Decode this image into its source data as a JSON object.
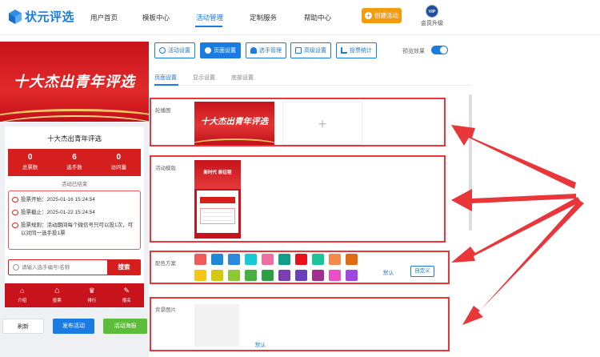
{
  "brand": {
    "name": "状元评选",
    "accent": "#1a7be0",
    "red": "#d51f1f"
  },
  "nav": {
    "items": [
      {
        "label": "用户首页"
      },
      {
        "label": "模板中心"
      },
      {
        "label": "活动管理"
      },
      {
        "label": "定制服务"
      },
      {
        "label": "帮助中心"
      }
    ],
    "active_index": 2,
    "create_label": "创建活动",
    "vip_badge": "VIP",
    "vip_label": "会员升级"
  },
  "preview": {
    "banner_title": "十大杰出青年评选",
    "activity_title": "十大杰出青年评选",
    "stats": [
      {
        "value": "0",
        "label": "总票数"
      },
      {
        "value": "6",
        "label": "选手数"
      },
      {
        "value": "0",
        "label": "访问量"
      }
    ],
    "status": "活动已结束",
    "info": [
      {
        "text": "投票开始：2025-01-16 15:24:54"
      },
      {
        "text": "投票截止：2025-01-22 15:24:54"
      },
      {
        "text": "投票规则：活动期间每个微信号只可以投1次，可以对同一选手投1票"
      }
    ],
    "search_placeholder": "请输入选手编号/名称",
    "search_button": "搜索",
    "tabs": [
      {
        "label": "介绍",
        "icon": "house-small-icon"
      },
      {
        "label": "投票",
        "icon": "home-icon"
      },
      {
        "label": "排行",
        "icon": "trophy-icon"
      },
      {
        "label": "报名",
        "icon": "signup-icon"
      }
    ]
  },
  "bottom_buttons": {
    "refresh": "刷新",
    "publish": "发布活动",
    "poster": "活动海报"
  },
  "toolbar": {
    "buttons": [
      {
        "label": "活动设置",
        "icon": "gear-icon"
      },
      {
        "label": "页面设置",
        "icon": "palette-icon"
      },
      {
        "label": "选手管理",
        "icon": "users-icon"
      },
      {
        "label": "高级设置",
        "icon": "sliders-icon"
      },
      {
        "label": "投票统计",
        "icon": "chart-icon"
      }
    ],
    "active_index": 1,
    "preview_label": "预览效果",
    "preview_on": true
  },
  "subtabs": {
    "items": [
      {
        "label": "页面设置"
      },
      {
        "label": "显示设置"
      },
      {
        "label": "底部设置"
      }
    ],
    "active_index": 0
  },
  "sections": {
    "carousel_label": "轮播图",
    "carousel_image_text": "十大杰出青年评选",
    "template_label": "活动模版",
    "template_banner_text": "新时代 新征程",
    "color_label": "配色方案",
    "colors_row1": [
      "#f05a5a",
      "#1e88d4",
      "#2a8ae0",
      "#18c9d4",
      "#ec6fa0",
      "#10a08a",
      "#e8121a",
      "#1cc49a",
      "#f5894a",
      "#e06a10"
    ],
    "colors_row2": [
      "#f5c518",
      "#d4c810",
      "#8bc834",
      "#48b040",
      "#2e9e46",
      "#7b3fb2",
      "#6a3fba",
      "#a03090",
      "#ec4ec8",
      "#a045e0"
    ],
    "color_default": "默认",
    "color_custom": "自定义",
    "bg_label": "背景图片",
    "bg_default": "默认"
  }
}
